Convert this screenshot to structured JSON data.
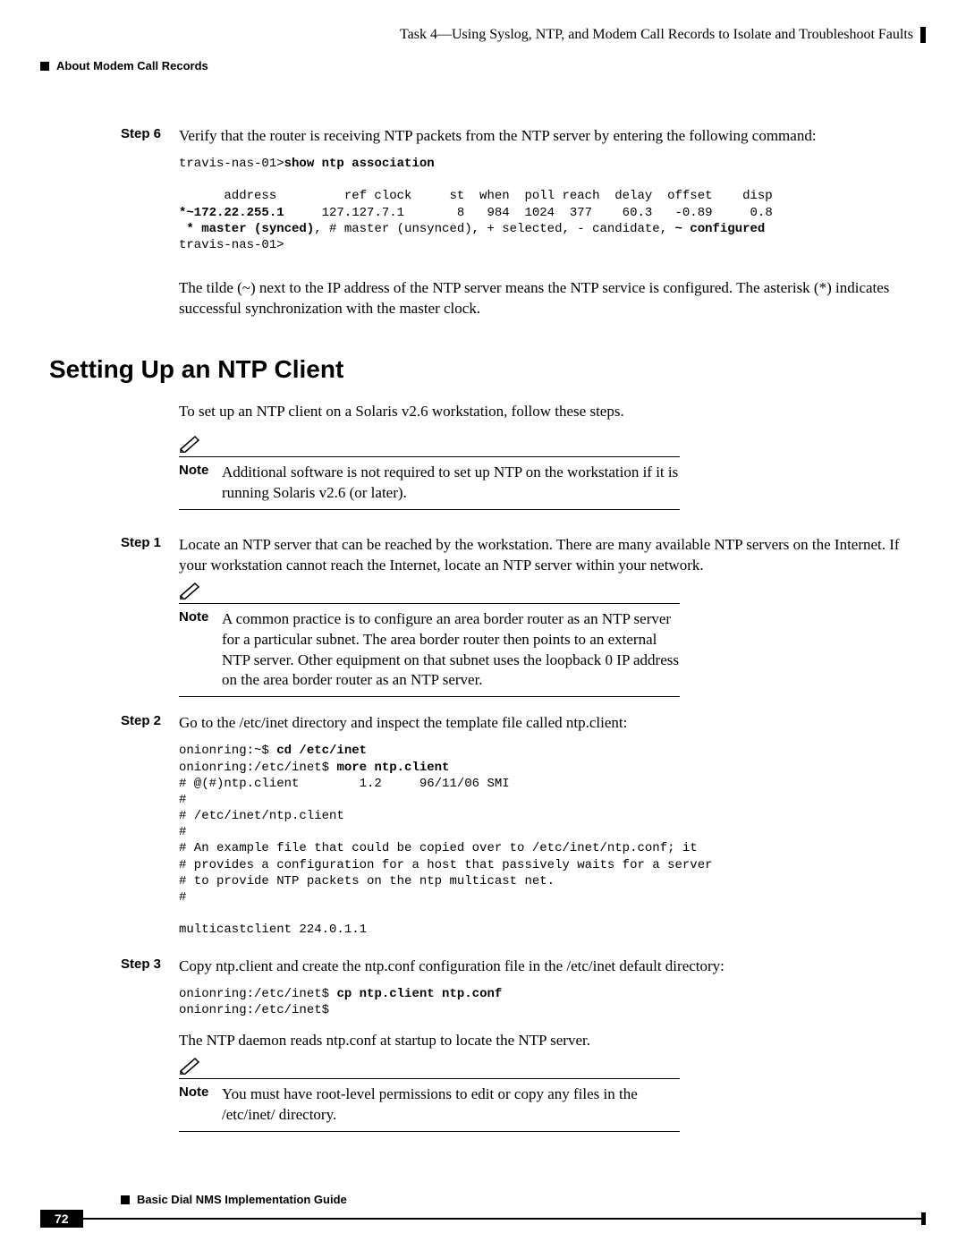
{
  "header": {
    "right_title": "Task 4—Using Syslog, NTP, and Modem Call Records to Isolate and Troubleshoot Faults",
    "left_title": "About Modem Call Records"
  },
  "step6": {
    "label": "Step 6",
    "text": "Verify that the router is receiving NTP packets from the NTP server by entering the following command:",
    "code_prompt": "travis-nas-01>",
    "code_cmd": "show ntp association",
    "code_header": "      address         ref clock     st  when  poll reach  delay  offset    disp",
    "code_row_bold": "*~172.22.255.1",
    "code_row_rest": "     127.127.7.1       8   984  1024  377    60.3   -0.89     0.8",
    "code_legend_bold1": " * master (synced)",
    "code_legend_mid": ", # master (unsynced), + selected, - candidate, ",
    "code_legend_bold2": "~ configured",
    "code_tail": "travis-nas-01>",
    "explain": "The tilde (~) next to the IP address of the NTP server means the NTP service is configured. The asterisk (*) indicates successful synchronization with the master clock."
  },
  "section_title": "Setting Up an NTP Client",
  "section_intro": "To set up an NTP client on a Solaris v2.6 workstation, follow these steps.",
  "note1": {
    "label": "Note",
    "text": "Additional software is not required to set up NTP on the workstation if it is running Solaris v2.6 (or later)."
  },
  "step1": {
    "label": "Step 1",
    "text": "Locate an NTP server that can be reached by the workstation. There are many available NTP servers on the Internet. If your workstation cannot reach the Internet, locate an NTP server within your network."
  },
  "note2": {
    "label": "Note",
    "text": "A common practice is to configure an area border router as an NTP server for a particular subnet. The area border router then points to an external NTP server. Other equipment on that subnet uses the loopback 0 IP address on the area border router as an NTP server."
  },
  "step2": {
    "label": "Step 2",
    "text": "Go to the /etc/inet directory and inspect the template file called ntp.client:",
    "code_p1": "onionring:~$ ",
    "code_c1": "cd /etc/inet",
    "code_p2": "onionring:/etc/inet$ ",
    "code_c2": "more ntp.client",
    "code_body": "# @(#)ntp.client        1.2     96/11/06 SMI\n#\n# /etc/inet/ntp.client\n#\n# An example file that could be copied over to /etc/inet/ntp.conf; it\n# provides a configuration for a host that passively waits for a server\n# to provide NTP packets on the ntp multicast net.\n#\n\nmulticastclient 224.0.1.1"
  },
  "step3": {
    "label": "Step 3",
    "text": "Copy ntp.client and create the ntp.conf configuration file in the /etc/inet default directory:",
    "code_p1": "onionring:/etc/inet$ ",
    "code_c1": "cp ntp.client ntp.conf",
    "code_p2": "onionring:/etc/inet$",
    "explain": "The NTP daemon reads ntp.conf at startup to locate the NTP server."
  },
  "note3": {
    "label": "Note",
    "text": "You must have root-level permissions to edit or copy any files in the /etc/inet/ directory."
  },
  "footer": {
    "guide": "Basic Dial NMS Implementation Guide",
    "page": "72"
  }
}
